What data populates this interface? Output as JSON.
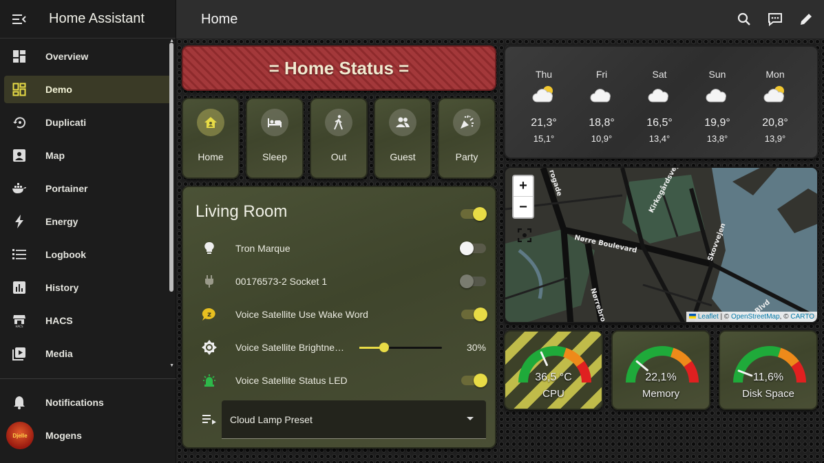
{
  "app": {
    "title": "Home Assistant"
  },
  "sidebar": {
    "items": [
      {
        "label": "Overview",
        "icon": "overview-grid-icon"
      },
      {
        "label": "Demo",
        "icon": "dashboard-icon",
        "active": true
      },
      {
        "label": "Duplicati",
        "icon": "backup-restore-icon"
      },
      {
        "label": "Map",
        "icon": "map-icon"
      },
      {
        "label": "Portainer",
        "icon": "docker-icon"
      },
      {
        "label": "Energy",
        "icon": "lightning-icon"
      },
      {
        "label": "Logbook",
        "icon": "list-icon"
      },
      {
        "label": "History",
        "icon": "chart-bar-icon"
      },
      {
        "label": "HACS",
        "icon": "hacs-store-icon"
      },
      {
        "label": "Media",
        "icon": "play-box-icon"
      }
    ],
    "notifications_label": "Notifications",
    "user_name": "Mogens",
    "avatar_text": "Djelle"
  },
  "header": {
    "title": "Home"
  },
  "status_banner": {
    "text": "= Home Status ="
  },
  "modes": [
    {
      "label": "Home",
      "active": true
    },
    {
      "label": "Sleep",
      "active": false
    },
    {
      "label": "Out",
      "active": false
    },
    {
      "label": "Guest",
      "active": false
    },
    {
      "label": "Party",
      "active": false
    }
  ],
  "living_room": {
    "title": "Living Room",
    "master_on": true,
    "rows": [
      {
        "label": "Tron Marque",
        "state": "off"
      },
      {
        "label": "00176573-2 Socket 1",
        "state": "unavailable"
      },
      {
        "label": "Voice Satellite Use Wake Word",
        "state": "on"
      },
      {
        "label": "Voice Satellite Brightne…",
        "value": "30%",
        "level": 0.3
      },
      {
        "label": "Voice Satellite Status LED",
        "state": "on"
      }
    ],
    "select": {
      "value": "Cloud Lamp Preset"
    }
  },
  "weather": [
    {
      "day": "Thu",
      "high": "21,3°",
      "low": "15,1°",
      "icon": "partly-cloudy-icon"
    },
    {
      "day": "Fri",
      "high": "18,8°",
      "low": "10,9°",
      "icon": "cloudy-icon"
    },
    {
      "day": "Sat",
      "high": "16,5°",
      "low": "13,4°",
      "icon": "cloudy-icon"
    },
    {
      "day": "Sun",
      "high": "19,9°",
      "low": "13,8°",
      "icon": "cloudy-icon"
    },
    {
      "day": "Mon",
      "high": "20,8°",
      "low": "13,9°",
      "icon": "partly-cloudy-icon"
    }
  ],
  "map": {
    "zoom_in": "+",
    "zoom_out": "−",
    "streets": [
      "rogade",
      "Kirkegårdsvej",
      "Nørre Boulevard",
      "Nørrebro",
      "Skovvejen",
      "Blvd"
    ],
    "attribution": {
      "leaflet": "Leaflet",
      "sep1": " | © ",
      "osm": "OpenStreetMap",
      "sep2": ", © ",
      "carto": "CARTO"
    }
  },
  "gauges": [
    {
      "value": "36,5 °C",
      "name": "CPU",
      "fraction": 0.365
    },
    {
      "value": "22,1%",
      "name": "Memory",
      "fraction": 0.221
    },
    {
      "value": "11,6%",
      "name": "Disk Space",
      "fraction": 0.116
    }
  ]
}
